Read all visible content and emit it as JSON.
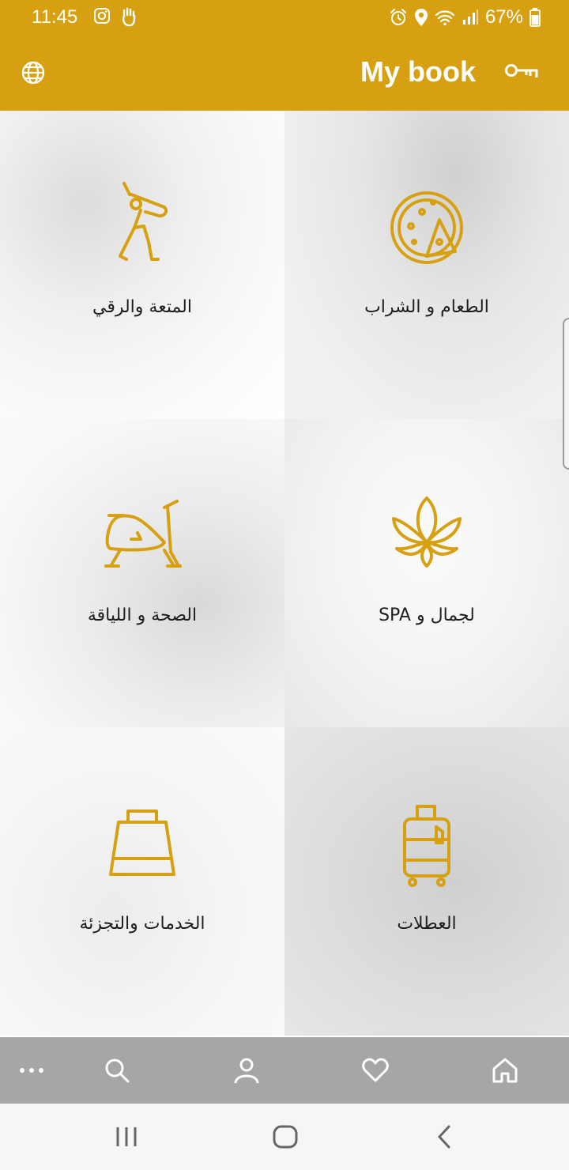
{
  "status_bar": {
    "time": "11:45",
    "battery": "67%",
    "left_icons": [
      "instagram-icon",
      "hand-icon"
    ],
    "right_icons": [
      "alarm-icon",
      "location-icon",
      "wifi-icon",
      "signal-icon",
      "battery-icon"
    ]
  },
  "app_bar": {
    "title": "My book",
    "left_icon": "globe-icon",
    "right_icon": "key-icon",
    "color": "#d6a010"
  },
  "tiles": [
    {
      "label": "المتعة والرقي",
      "icon": "golfer-icon"
    },
    {
      "label": "الطعام و الشراب",
      "icon": "pizza-icon"
    },
    {
      "label": "الصحة و اللياقة",
      "icon": "exercise-bike-icon"
    },
    {
      "label": "لجمال و SPA",
      "icon": "lotus-icon"
    },
    {
      "label": "الخدمات والتجزئة",
      "icon": "shopping-bag-icon"
    },
    {
      "label": "العطلات",
      "icon": "luggage-icon"
    }
  ],
  "bottom_nav": [
    "more-icon",
    "search-icon",
    "profile-icon",
    "favorites-icon",
    "home-icon"
  ],
  "system_nav": [
    "recent-apps-button",
    "home-button",
    "back-button"
  ],
  "accent_color": "#d6a010"
}
